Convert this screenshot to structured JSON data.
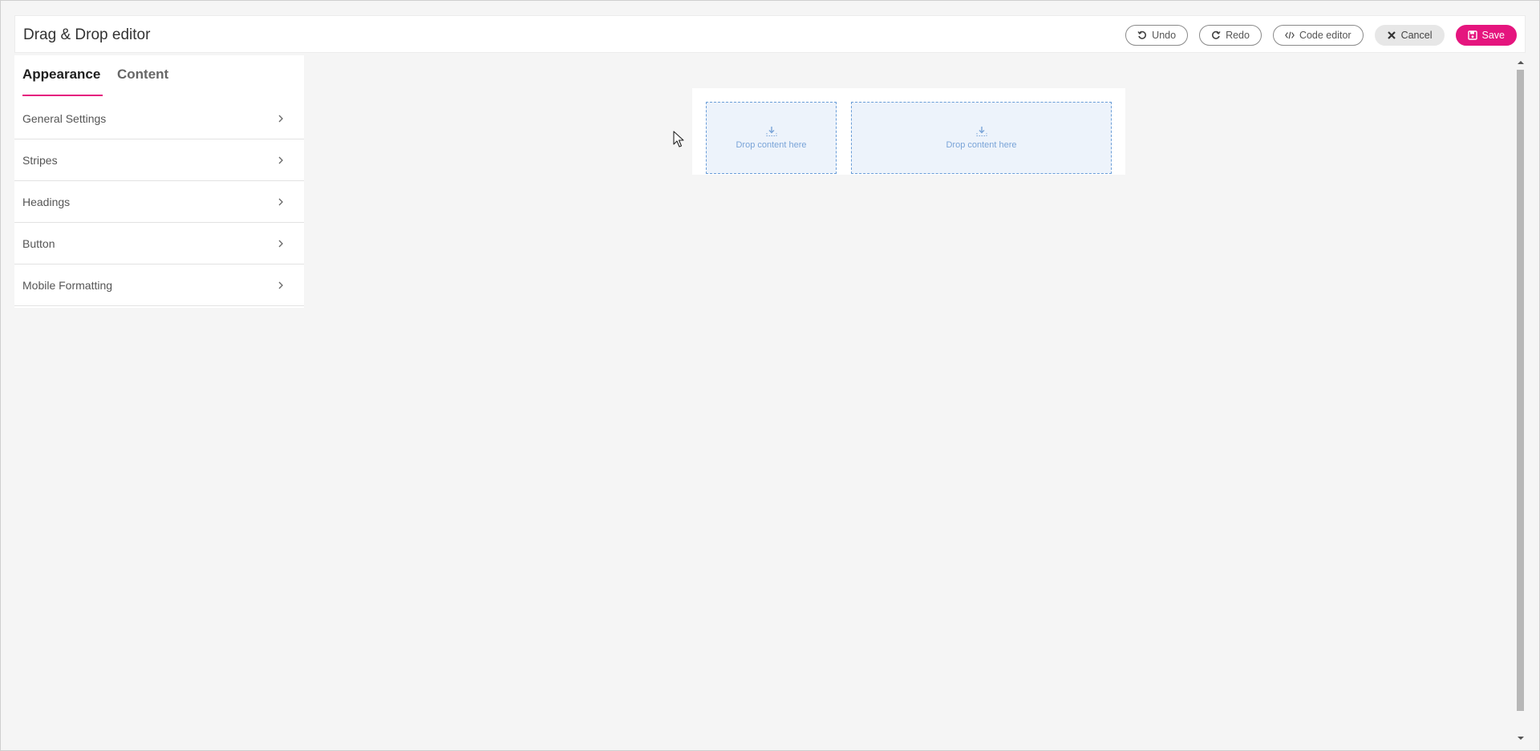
{
  "header": {
    "title": "Drag & Drop editor",
    "buttons": {
      "undo": "Undo",
      "redo": "Redo",
      "code_editor": "Code editor",
      "cancel": "Cancel",
      "save": "Save"
    }
  },
  "sidebar": {
    "tabs": [
      {
        "label": "Appearance",
        "active": true
      },
      {
        "label": "Content",
        "active": false
      }
    ],
    "items": [
      {
        "label": "General Settings"
      },
      {
        "label": "Stripes"
      },
      {
        "label": "Headings"
      },
      {
        "label": "Button"
      },
      {
        "label": "Mobile Formatting"
      }
    ]
  },
  "canvas": {
    "dropzones": [
      {
        "label": "Drop content here"
      },
      {
        "label": "Drop content here"
      }
    ]
  },
  "colors": {
    "accent": "#e5157e",
    "dropzone_border": "#6b9ed8",
    "dropzone_bg": "#edf3fb"
  }
}
